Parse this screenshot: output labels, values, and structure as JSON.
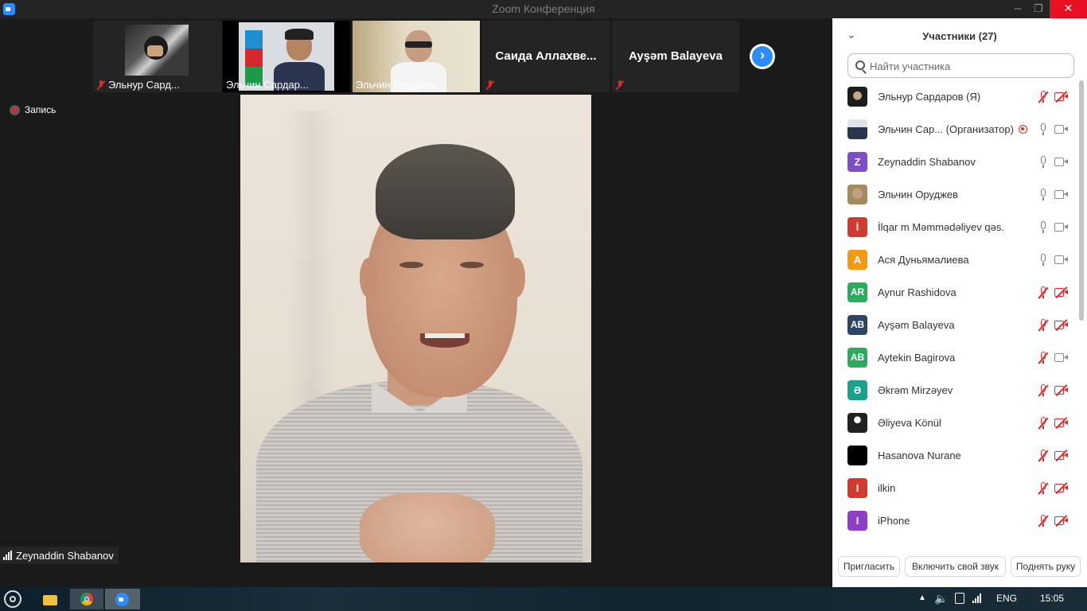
{
  "window": {
    "title": "Zoom Конференция",
    "minimize": "─",
    "maximize": "❐",
    "close": "✕"
  },
  "gallery": {
    "thumbs": [
      {
        "name": "Эльнур Сард..."
      },
      {
        "name": "Эльчин Сардар..."
      },
      {
        "name": "Эльчин Оруджев"
      },
      {
        "name": "Саида  Аллахве..."
      },
      {
        "name": "Ayşəm Balayeva"
      }
    ],
    "next_arrow": "›"
  },
  "recording": {
    "label": "Запись"
  },
  "main_speaker": {
    "name": "Zeynaddin Shabanov"
  },
  "panel": {
    "collapse": "⌄",
    "title": "Участники (27)",
    "search_placeholder": "Найти участника",
    "participants": [
      {
        "name": "Эльнур Сардаров (Я)",
        "avatar": "photo",
        "mic": "off",
        "cam": "off"
      },
      {
        "name": "Эльчин Сар...  (Организатор)",
        "avatar": "photo",
        "mic": "on",
        "cam": "on",
        "recording": true
      },
      {
        "name": "Zeynaddin Shabanov",
        "initials": "Z",
        "color": "#7c4fc4",
        "mic": "on",
        "cam": "on"
      },
      {
        "name": "Эльчин Оруджев",
        "avatar": "photo",
        "mic": "on",
        "cam": "on"
      },
      {
        "name": "İlqar m Məmmədəliyev qəs.",
        "initials": "İ",
        "color": "#d03a2f",
        "mic": "on",
        "cam": "on"
      },
      {
        "name": "Ася Дуньямалиева",
        "initials": "A",
        "color": "#f29a12",
        "mic": "on",
        "cam": "on"
      },
      {
        "name": "Aynur Rashidova",
        "initials": "AR",
        "color": "#2bac5c",
        "mic": "off",
        "cam": "off"
      },
      {
        "name": "Ayşəm Balayeva",
        "initials": "AB",
        "color": "#2e4566",
        "mic": "off",
        "cam": "off"
      },
      {
        "name": "Aytekin Bagirova",
        "initials": "AB",
        "color": "#2bac5c",
        "mic": "off",
        "cam": "on"
      },
      {
        "name": "Əkrəm Mirzəyev",
        "initials": "Ə",
        "color": "#18a28e",
        "mic": "off",
        "cam": "off"
      },
      {
        "name": "Əliyeva Könül",
        "avatar": "photo",
        "mic": "off",
        "cam": "off"
      },
      {
        "name": "Hasanova Nurane",
        "avatar": "black",
        "mic": "off",
        "cam": "off"
      },
      {
        "name": "ilkin",
        "initials": "I",
        "color": "#d03a2f",
        "mic": "off",
        "cam": "off"
      },
      {
        "name": "iPhone",
        "initials": "I",
        "color": "#8e3fc6",
        "mic": "off",
        "cam": "off"
      }
    ],
    "footer": {
      "invite": "Пригласить",
      "unmute": "Включить свой звук",
      "raise_hand": "Поднять руку"
    }
  },
  "taskbar": {
    "language": "ENG",
    "time": "15:05"
  },
  "colors": {
    "accent": "#2d8cff",
    "muted": "#e02828",
    "background": "#1a1a1a"
  }
}
